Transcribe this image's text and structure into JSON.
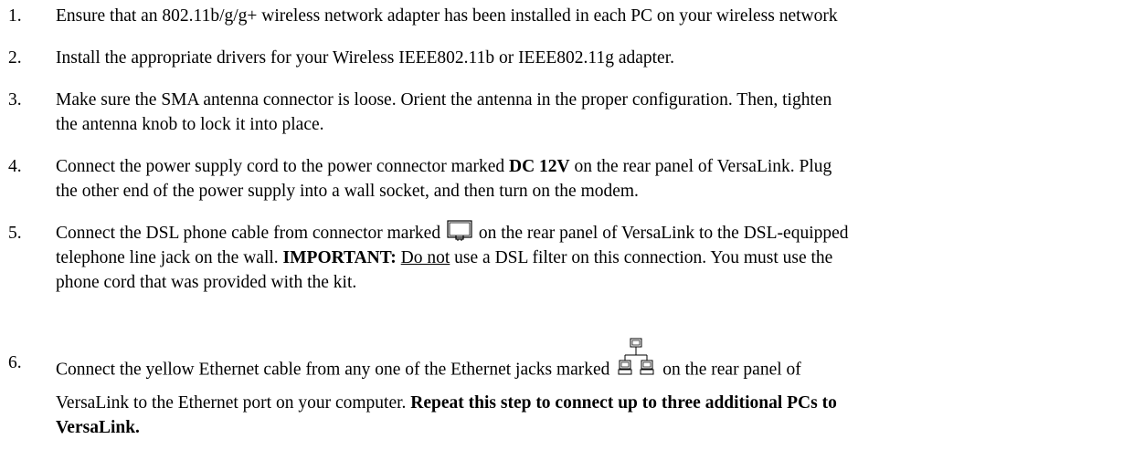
{
  "steps": [
    {
      "number": "1.",
      "text": "Ensure that an 802.11b/g/g+ wireless network adapter has been installed in each PC on your wireless network"
    },
    {
      "number": "2.",
      "text": "Install the appropriate drivers for your Wireless IEEE802.11b or IEEE802.11g adapter."
    },
    {
      "number": "3.",
      "line1": "Make sure the SMA antenna connector is loose. Orient the antenna in the proper configuration. Then, tighten",
      "line2": "the antenna knob to lock it into place."
    },
    {
      "number": "4.",
      "line1_a": "Connect the power supply cord to the power connector marked ",
      "line1_bold": "DC 12V",
      "line1_b": " on the rear panel of VersaLink. Plug",
      "line2": "the other end of the power supply into a wall socket, and then turn on the modem."
    },
    {
      "number": "5.",
      "line1_a": "Connect the DSL phone cable from connector marked ",
      "line1_b": " on the rear panel of VersaLink to the DSL-equipped",
      "line2_a": "telephone line jack on the wall. ",
      "line2_bold": "IMPORTANT:",
      "line2_underline": "Do not",
      "line2_b": " use a DSL filter on this connection. You must use the",
      "line3": "phone cord that was provided with the kit.",
      "icon": "phone-jack-icon"
    },
    {
      "number": "6.",
      "line1_a": "Connect the yellow Ethernet cable from any one of the Ethernet jacks marked ",
      "line1_b": " on the rear panel of",
      "line2_a": "VersaLink to the Ethernet port on your computer. ",
      "line2_bold": "Repeat this step to connect up to three additional PCs to",
      "line3_bold": "VersaLink.",
      "icon": "ethernet-network-icon"
    }
  ]
}
